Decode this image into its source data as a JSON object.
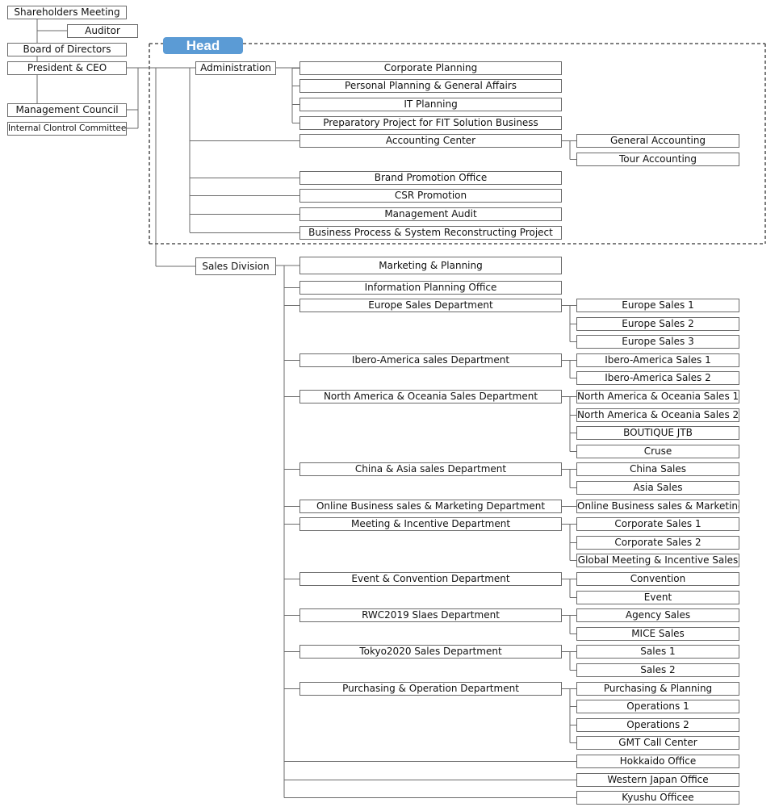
{
  "colors": {
    "head_label_bg": "#5b9bd5",
    "box_border": "#6b6b6b",
    "line": "#6b6b6b"
  },
  "governance": {
    "shareholders": "Shareholders Meeting",
    "auditor": "Auditor",
    "board": "Board of Directors",
    "president": "President & CEO",
    "management_council": "Management Council",
    "internal_control": "Internal Clontrol Committee"
  },
  "head_group": {
    "label": "Head",
    "administration": "Administration",
    "admin_units": [
      "Corporate Planning",
      "Personal Planning & General Affairs",
      "IT Planning",
      "Preparatory Project for FIT Solution Business"
    ],
    "accounting_center": "Accounting Center",
    "accounting_units": [
      "General Accounting",
      "Tour Accounting"
    ],
    "other_units": [
      "Brand Promotion Office",
      "CSR Promotion",
      "Management Audit",
      "Business Process & System Reconstructing Project"
    ]
  },
  "sales_division": {
    "label": "Sales Division",
    "direct_units": [
      "Marketing & Planning",
      "Information Planning Office"
    ],
    "departments": [
      {
        "name": "Europe Sales Department",
        "units": [
          "Europe Sales 1",
          "Europe Sales 2",
          "Europe Sales 3"
        ]
      },
      {
        "name": "Ibero-America sales Department",
        "units": [
          "Ibero-America Sales 1",
          "Ibero-America Sales 2"
        ]
      },
      {
        "name": "North America & Oceania Sales Department",
        "units": [
          "North America & Oceania Sales 1",
          "North America & Oceania Sales 2",
          "BOUTIQUE JTB",
          "Cruse"
        ]
      },
      {
        "name": "China & Asia sales Department",
        "units": [
          "China Sales",
          "Asia Sales"
        ]
      },
      {
        "name": "Online Business sales & Marketing Department",
        "units": [
          "Online Business sales & Marketing"
        ]
      },
      {
        "name": "Meeting & Incentive Department",
        "units": [
          "Corporate Sales 1",
          "Corporate Sales 2",
          "Global Meeting & Incentive Sales"
        ]
      },
      {
        "name": "Event & Convention Department",
        "units": [
          "Convention",
          "Event"
        ]
      },
      {
        "name": "RWC2019 Slaes Department",
        "units": [
          "Agency Sales",
          "MICE Sales"
        ]
      },
      {
        "name": "Tokyo2020 Sales Department",
        "units": [
          "Sales 1",
          "Sales 2"
        ]
      },
      {
        "name": "Purchasing & Operation Department",
        "units": [
          "Purchasing & Planning",
          "Operations 1",
          "Operations 2",
          "GMT Call Center"
        ]
      }
    ],
    "offices": [
      "Hokkaido Office",
      "Western Japan Office",
      "Kyushu Officee"
    ]
  }
}
